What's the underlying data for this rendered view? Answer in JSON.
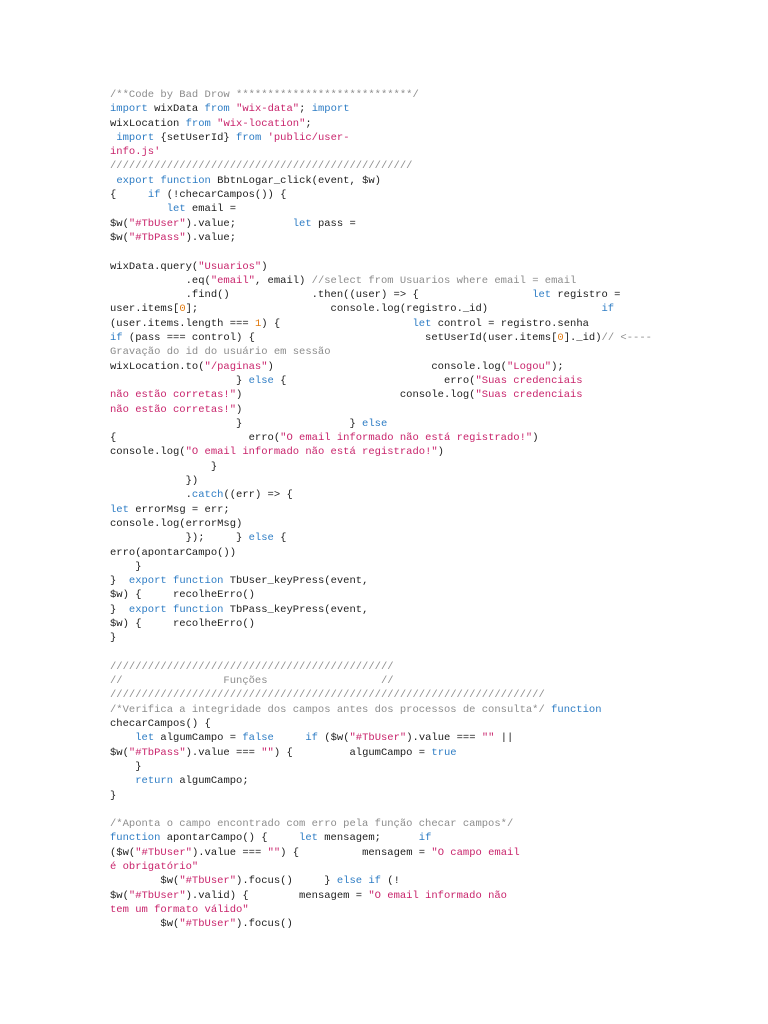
{
  "document": {
    "colors": {
      "keyword": "#2d7cc4",
      "string": "#c8236b",
      "comment": "#8c8c8c",
      "number": "#e07a10",
      "text": "#1c1c1c"
    },
    "lines": [
      [
        [
          "c",
          "/**Code by Bad Drow ****************************/"
        ]
      ],
      [
        [
          "k",
          "import"
        ],
        [
          "n",
          " wixData "
        ],
        [
          "k",
          "from"
        ],
        [
          "n",
          " "
        ],
        [
          "s",
          "\"wix-data\""
        ],
        [
          "n",
          "; "
        ],
        [
          "k",
          "import"
        ]
      ],
      [
        [
          "n",
          "wixLocation "
        ],
        [
          "k",
          "from"
        ],
        [
          "n",
          " "
        ],
        [
          "s",
          "\"wix-location\""
        ],
        [
          "n",
          ";"
        ]
      ],
      [
        [
          "n",
          " "
        ],
        [
          "k",
          "import"
        ],
        [
          "n",
          " {setUserId} "
        ],
        [
          "k",
          "from"
        ],
        [
          "n",
          " "
        ],
        [
          "s",
          "'public/user-"
        ]
      ],
      [
        [
          "s",
          "info.js'"
        ]
      ],
      [
        [
          "c",
          "////////////////////////////////////////////////"
        ]
      ],
      [
        [
          "n",
          " "
        ],
        [
          "k",
          "export"
        ],
        [
          "n",
          " "
        ],
        [
          "k",
          "function"
        ],
        [
          "n",
          " BbtnLogar_click(event, $w)"
        ]
      ],
      [
        [
          "n",
          "{     "
        ],
        [
          "k",
          "if"
        ],
        [
          "n",
          " (!checarCampos()) {"
        ]
      ],
      [
        [
          "n",
          "         "
        ],
        [
          "k",
          "let"
        ],
        [
          "n",
          " email ="
        ]
      ],
      [
        [
          "n",
          "$w("
        ],
        [
          "s",
          "\"#TbUser\""
        ],
        [
          "n",
          ").value;         "
        ],
        [
          "k",
          "let"
        ],
        [
          "n",
          " pass ="
        ]
      ],
      [
        [
          "n",
          "$w("
        ],
        [
          "s",
          "\"#TbPass\""
        ],
        [
          "n",
          ").value;"
        ]
      ],
      [],
      [
        [
          "n",
          "wixData.query("
        ],
        [
          "s",
          "\"Usuarios\""
        ],
        [
          "n",
          ")"
        ]
      ],
      [
        [
          "n",
          "            .eq("
        ],
        [
          "s",
          "\"email\""
        ],
        [
          "n",
          ", email) "
        ],
        [
          "c",
          "//select from Usuarios where email = email"
        ]
      ],
      [
        [
          "n",
          "            .find()             .then((user) => {                  "
        ],
        [
          "k",
          "let"
        ],
        [
          "n",
          " registro ="
        ]
      ],
      [
        [
          "n",
          "user.items["
        ],
        [
          "m",
          "0"
        ],
        [
          "n",
          "];                     console.log(registro._id)                  "
        ],
        [
          "k",
          "if"
        ]
      ],
      [
        [
          "n",
          "(user.items.length === "
        ],
        [
          "m",
          "1"
        ],
        [
          "n",
          ") {                     "
        ],
        [
          "k",
          "let"
        ],
        [
          "n",
          " control = registro.senha"
        ]
      ],
      [
        [
          "k",
          "if"
        ],
        [
          "n",
          " (pass === control) {                           setUserId(user.items["
        ],
        [
          "m",
          "0"
        ],
        [
          "n",
          "]._id)"
        ],
        [
          "c",
          "// <----"
        ]
      ],
      [
        [
          "c",
          "Gravação do id do usuário em sessão"
        ]
      ],
      [
        [
          "n",
          "wixLocation.to("
        ],
        [
          "s",
          "\"/paginas\""
        ],
        [
          "n",
          ")                         console.log("
        ],
        [
          "s",
          "\"Logou\""
        ],
        [
          "n",
          ");"
        ]
      ],
      [
        [
          "n",
          "                    } "
        ],
        [
          "k",
          "else"
        ],
        [
          "n",
          " {                         erro("
        ],
        [
          "s",
          "\"Suas credenciais"
        ]
      ],
      [
        [
          "s",
          "não estão corretas!\""
        ],
        [
          "n",
          ")                         console.log("
        ],
        [
          "s",
          "\"Suas credenciais"
        ]
      ],
      [
        [
          "s",
          "não estão corretas!\""
        ],
        [
          "n",
          ")"
        ]
      ],
      [
        [
          "n",
          "                    }                 } "
        ],
        [
          "k",
          "else"
        ]
      ],
      [
        [
          "n",
          "{                     erro("
        ],
        [
          "s",
          "\"O email informado não está registrado!\""
        ],
        [
          "n",
          ")"
        ]
      ],
      [
        [
          "n",
          "console.log("
        ],
        [
          "s",
          "\"O email informado não está registrado!\""
        ],
        [
          "n",
          ")"
        ]
      ],
      [
        [
          "n",
          "                }"
        ]
      ],
      [
        [
          "n",
          "            })"
        ]
      ],
      [
        [
          "n",
          "            ."
        ],
        [
          "k",
          "catch"
        ],
        [
          "n",
          "((err) => {"
        ]
      ],
      [
        [
          "k",
          "let"
        ],
        [
          "n",
          " errorMsg = err;"
        ]
      ],
      [
        [
          "n",
          "console.log(errorMsg)"
        ]
      ],
      [
        [
          "n",
          "            });     } "
        ],
        [
          "k",
          "else"
        ],
        [
          "n",
          " {"
        ]
      ],
      [
        [
          "n",
          "erro(apontarCampo())"
        ]
      ],
      [
        [
          "n",
          "    }"
        ]
      ],
      [
        [
          "n",
          "}  "
        ],
        [
          "k",
          "export"
        ],
        [
          "n",
          " "
        ],
        [
          "k",
          "function"
        ],
        [
          "n",
          " TbUser_keyPress(event,"
        ]
      ],
      [
        [
          "n",
          "$w) {     recolheErro()"
        ]
      ],
      [
        [
          "n",
          "}  "
        ],
        [
          "k",
          "export"
        ],
        [
          "n",
          " "
        ],
        [
          "k",
          "function"
        ],
        [
          "n",
          " TbPass_keyPress(event,"
        ]
      ],
      [
        [
          "n",
          "$w) {     recolheErro()"
        ]
      ],
      [
        [
          "n",
          "}"
        ]
      ],
      [],
      [
        [
          "c",
          "/////////////////////////////////////////////"
        ]
      ],
      [
        [
          "c",
          "//                Funções                  //"
        ]
      ],
      [
        [
          "c",
          "/////////////////////////////////////////////////////////////////////"
        ]
      ],
      [
        [
          "c",
          "/*Verifica a integridade dos campos antes dos processos de consulta*/"
        ],
        [
          "n",
          " "
        ],
        [
          "k",
          "function"
        ]
      ],
      [
        [
          "n",
          "checarCampos() {"
        ]
      ],
      [
        [
          "n",
          "    "
        ],
        [
          "k",
          "let"
        ],
        [
          "n",
          " algumCampo = "
        ],
        [
          "k",
          "false"
        ],
        [
          "n",
          "     "
        ],
        [
          "k",
          "if"
        ],
        [
          "n",
          " ($w("
        ],
        [
          "s",
          "\"#TbUser\""
        ],
        [
          "n",
          ").value === "
        ],
        [
          "s",
          "\"\""
        ],
        [
          "n",
          " ||"
        ]
      ],
      [
        [
          "n",
          "$w("
        ],
        [
          "s",
          "\"#TbPass\""
        ],
        [
          "n",
          ").value === "
        ],
        [
          "s",
          "\"\""
        ],
        [
          "n",
          ") {         algumCampo = "
        ],
        [
          "k",
          "true"
        ]
      ],
      [
        [
          "n",
          "    }"
        ]
      ],
      [
        [
          "n",
          "    "
        ],
        [
          "k",
          "return"
        ],
        [
          "n",
          " algumCampo;"
        ]
      ],
      [
        [
          "n",
          "}"
        ]
      ],
      [],
      [
        [
          "c",
          "/*Aponta o campo encontrado com erro pela função checar campos*/"
        ]
      ],
      [
        [
          "k",
          "function"
        ],
        [
          "n",
          " apontarCampo() {     "
        ],
        [
          "k",
          "let"
        ],
        [
          "n",
          " mensagem;      "
        ],
        [
          "k",
          "if"
        ]
      ],
      [
        [
          "n",
          "($w("
        ],
        [
          "s",
          "\"#TbUser\""
        ],
        [
          "n",
          ").value === "
        ],
        [
          "s",
          "\"\""
        ],
        [
          "n",
          ") {          mensagem = "
        ],
        [
          "s",
          "\"O campo email"
        ]
      ],
      [
        [
          "s",
          "é obrigatório\""
        ]
      ],
      [
        [
          "n",
          "        $w("
        ],
        [
          "s",
          "\"#TbUser\""
        ],
        [
          "n",
          ").focus()     } "
        ],
        [
          "k",
          "else if"
        ],
        [
          "n",
          " (!"
        ]
      ],
      [
        [
          "n",
          "$w("
        ],
        [
          "s",
          "\"#TbUser\""
        ],
        [
          "n",
          ").valid) {        mensagem = "
        ],
        [
          "s",
          "\"O email informado não"
        ]
      ],
      [
        [
          "s",
          "tem um formato válido\""
        ]
      ],
      [
        [
          "n",
          "        $w("
        ],
        [
          "s",
          "\"#TbUser\""
        ],
        [
          "n",
          ").focus()"
        ]
      ]
    ]
  }
}
